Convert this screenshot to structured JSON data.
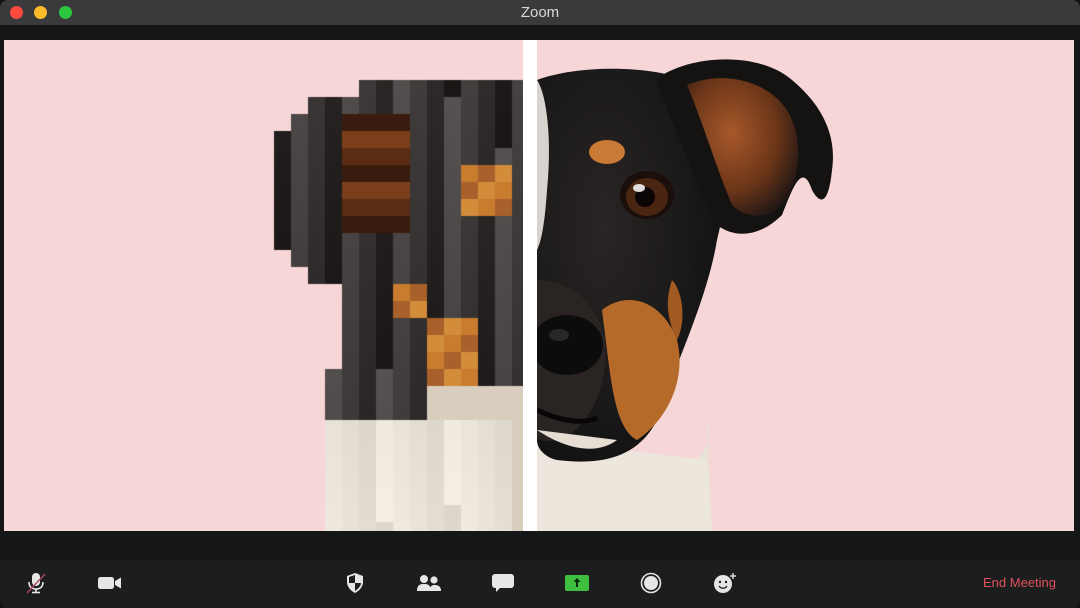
{
  "window": {
    "title": "Zoom"
  },
  "video": {
    "background_color": "#f7d6d8",
    "left_half": "pixelated-dog-image",
    "right_half": "dog-photo",
    "divider_color": "#ffffff"
  },
  "toolbar": {
    "buttons": [
      {
        "name": "mute-microphone",
        "icon": "microphone-muted-icon"
      },
      {
        "name": "video",
        "icon": "video-camera-icon"
      },
      {
        "name": "security",
        "icon": "shield-icon"
      },
      {
        "name": "participants",
        "icon": "participants-icon"
      },
      {
        "name": "chat",
        "icon": "chat-bubble-icon"
      },
      {
        "name": "share-screen",
        "icon": "share-screen-icon",
        "accent": "#3fbf3f"
      },
      {
        "name": "record",
        "icon": "record-icon"
      },
      {
        "name": "reactions",
        "icon": "reactions-icon"
      }
    ],
    "end_meeting_label": "End Meeting",
    "end_meeting_color": "#e0525a"
  }
}
